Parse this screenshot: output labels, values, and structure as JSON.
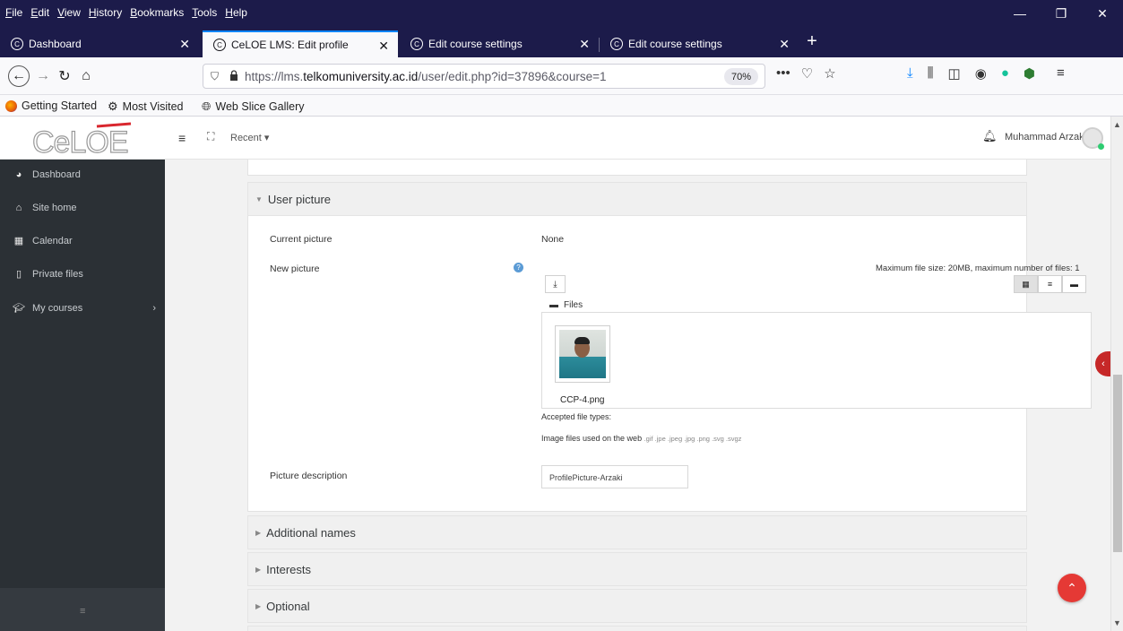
{
  "menubar": {
    "items": [
      "File",
      "Edit",
      "View",
      "History",
      "Bookmarks",
      "Tools",
      "Help"
    ],
    "controls": {
      "minimize": "—",
      "restore": "❐",
      "close": "✕"
    }
  },
  "tabs": [
    {
      "label": "Dashboard"
    },
    {
      "label": "CeLOE LMS: Edit profile"
    },
    {
      "label": "Edit course settings"
    },
    {
      "label": "Edit course settings"
    }
  ],
  "toolbar": {
    "url_prefix": "https://lms.",
    "url_domain": "telkomuniversity.ac.id",
    "url_suffix": "/user/edit.php?id=37896&course=1",
    "zoom": "70%"
  },
  "bookmarks": [
    {
      "label": "Getting Started",
      "icon": "firefox-icon"
    },
    {
      "label": "Most Visited",
      "icon": "gear-icon"
    },
    {
      "label": "Web Slice Gallery",
      "icon": "globe-icon"
    }
  ],
  "site": {
    "recent": "Recent ▾",
    "user_name": "Muhammad Arzaki"
  },
  "sidebar": {
    "items": [
      {
        "label": "Dashboard",
        "icon": "dashboard-icon"
      },
      {
        "label": "Site home",
        "icon": "home-icon"
      },
      {
        "label": "Calendar",
        "icon": "calendar-icon"
      },
      {
        "label": "Private files",
        "icon": "file-icon"
      },
      {
        "label": "My courses",
        "icon": "graduation-cap-icon"
      }
    ]
  },
  "form": {
    "section_title": "User picture",
    "current_picture_label": "Current picture",
    "current_picture_value": "None",
    "new_picture_label": "New picture",
    "max_size": "Maximum file size: 20MB, maximum number of files: 1",
    "files_crumb": "Files",
    "file_name": "CCP-4.png",
    "accepted_label": "Accepted file types:",
    "types_label": "Image files used on the web",
    "types_ext": ".gif .jpe .jpeg .jpg .png .svg .svgz",
    "description_label": "Picture description",
    "description_value": "ProfilePicture-Arzaki"
  },
  "collapsed_sections": [
    {
      "label": "Additional names"
    },
    {
      "label": "Interests"
    },
    {
      "label": "Optional"
    }
  ]
}
